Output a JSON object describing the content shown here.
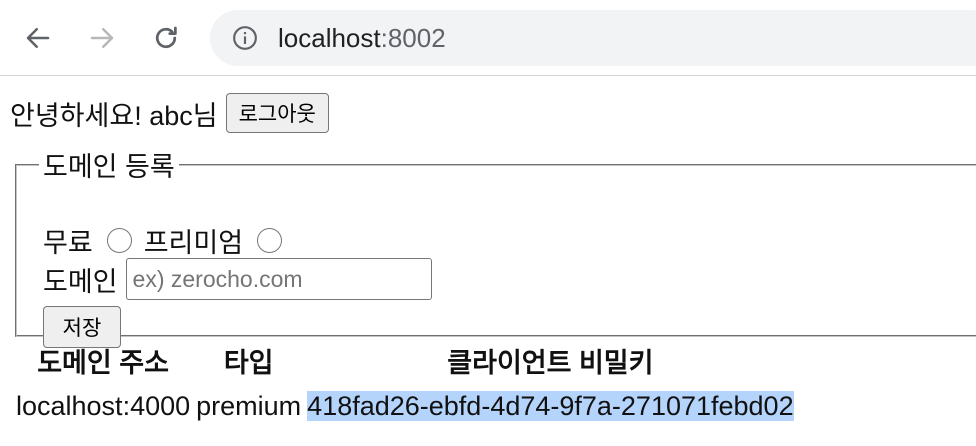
{
  "browser": {
    "url_host": "localhost",
    "url_port": ":8002"
  },
  "header": {
    "greeting": "안녕하세요! abc님",
    "logout_label": "로그아웃"
  },
  "form": {
    "legend": "도메인 등록",
    "type_options": [
      {
        "label": "무료",
        "checked": false
      },
      {
        "label": "프리미엄",
        "checked": false
      }
    ],
    "domain_label": "도메인",
    "domain_value": "",
    "domain_placeholder": "ex) zerocho.com",
    "save_label": "저장"
  },
  "table": {
    "headers": [
      "도메인 주소",
      "타입",
      "클라이언트 비밀키"
    ],
    "rows": [
      {
        "host": "localhost:4000",
        "type": "premium",
        "client_secret": "418fad26-ebfd-4d74-9f7a-271071febd02"
      }
    ]
  }
}
